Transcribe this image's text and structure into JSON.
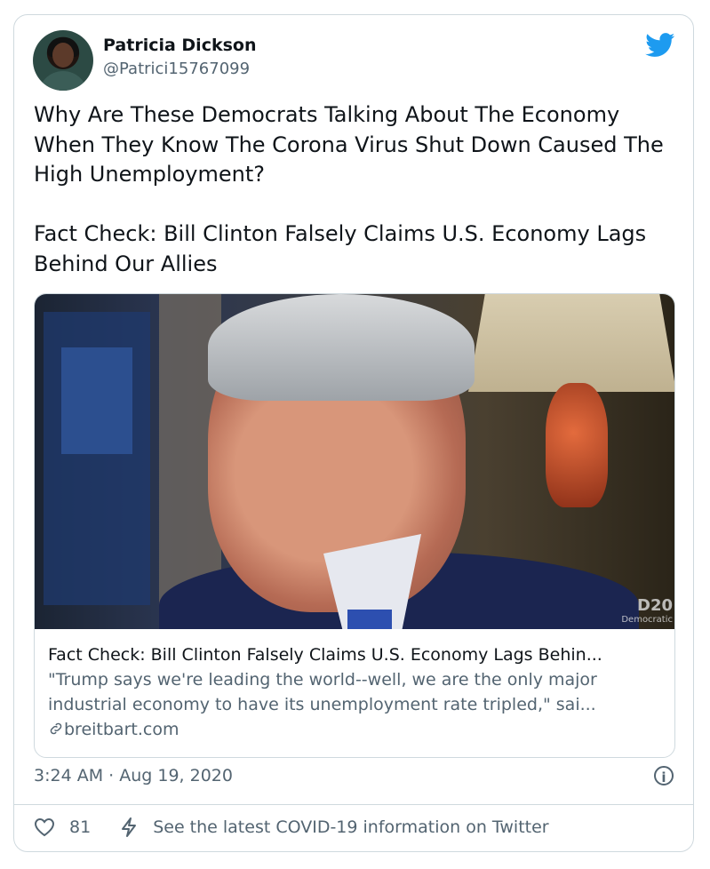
{
  "user": {
    "name": "Patricia Dickson",
    "handle": "@Patrici15767099"
  },
  "tweet": {
    "text": "Why Are These Democrats Talking About The Economy When They Know The Corona Virus Shut Down Caused The High Unemployment?\n\nFact Check: Bill Clinton Falsely Claims U.S. Economy Lags Behind Our Allies"
  },
  "link_card": {
    "image_watermark_top": "D20",
    "image_watermark_bottom": "Democratic",
    "title": "Fact Check: Bill Clinton Falsely Claims U.S. Economy Lags Behin...",
    "description": "\"Trump says we're leading the world--well, we are the only major industrial economy to have its unemployment rate tripled,\" sai...",
    "domain": "breitbart.com",
    "link_icon": "link-icon"
  },
  "meta": {
    "timestamp": "3:24 AM · Aug 19, 2020",
    "info_icon": "i"
  },
  "actions": {
    "likes": "81",
    "covid_link": "See the latest COVID-19 information on Twitter"
  },
  "colors": {
    "twitter_blue": "#1d9bf0",
    "text_primary": "#0f1419",
    "text_secondary": "#536471",
    "border": "#cfd9de"
  }
}
